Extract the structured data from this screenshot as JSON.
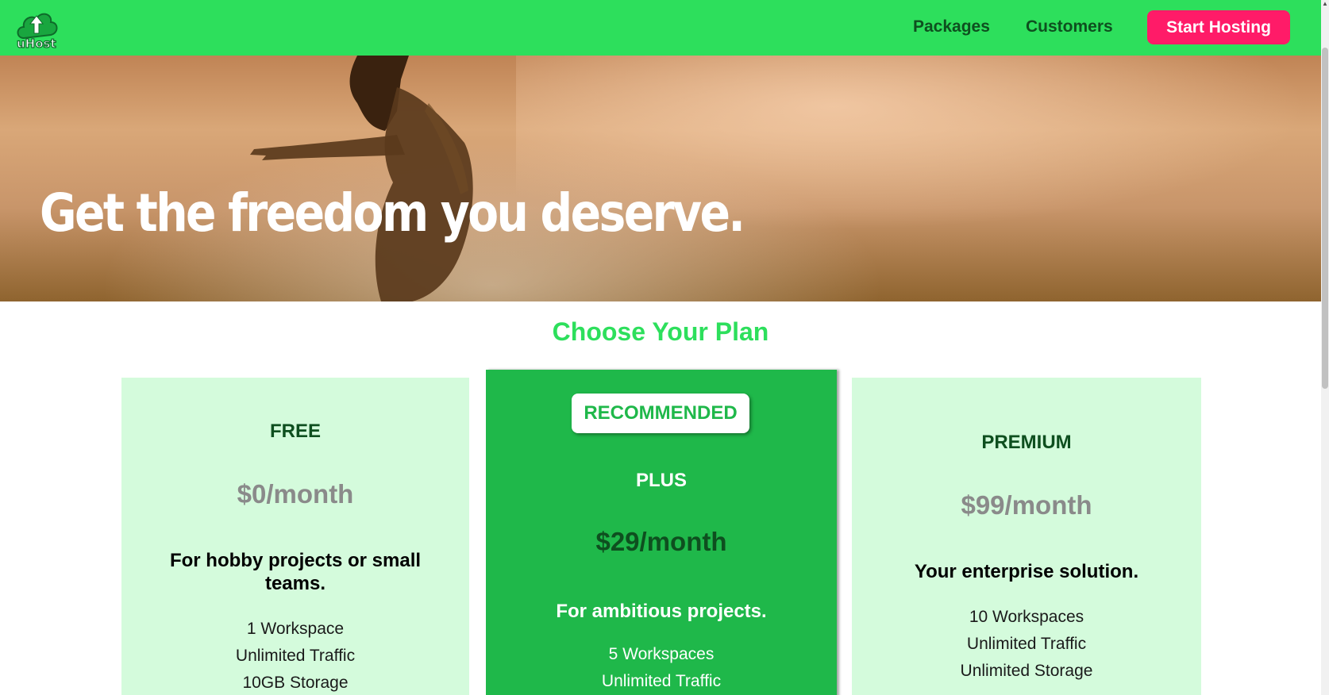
{
  "header": {
    "logo_text": "uHost",
    "nav": [
      "Packages",
      "Customers"
    ],
    "cta_label": "Start Hosting"
  },
  "hero": {
    "title": "Get the freedom you deserve."
  },
  "plans_section": {
    "title": "Choose Your Plan",
    "plans": [
      {
        "name": "FREE",
        "price": "$0/month",
        "description": "For hobby projects or small teams.",
        "features": [
          "1 Workspace",
          "Unlimited Traffic",
          "10GB Storage"
        ]
      },
      {
        "badge": "RECOMMENDED",
        "name": "PLUS",
        "price": "$29/month",
        "description": "For ambitious projects.",
        "features": [
          "5 Workspaces",
          "Unlimited Traffic"
        ]
      },
      {
        "name": "PREMIUM",
        "price": "$99/month",
        "description": "Your enterprise solution.",
        "features": [
          "10 Workspaces",
          "Unlimited Traffic",
          "Unlimited Storage"
        ]
      }
    ]
  },
  "colors": {
    "brand_green": "#2ddf5c",
    "recommended_green": "#1fb84a",
    "plan_bg": "#d4fbdc",
    "cta_pink": "#ff1b68",
    "dark_green": "#0e4f1f"
  },
  "icons": {
    "logo": "cloud-upload-icon"
  }
}
